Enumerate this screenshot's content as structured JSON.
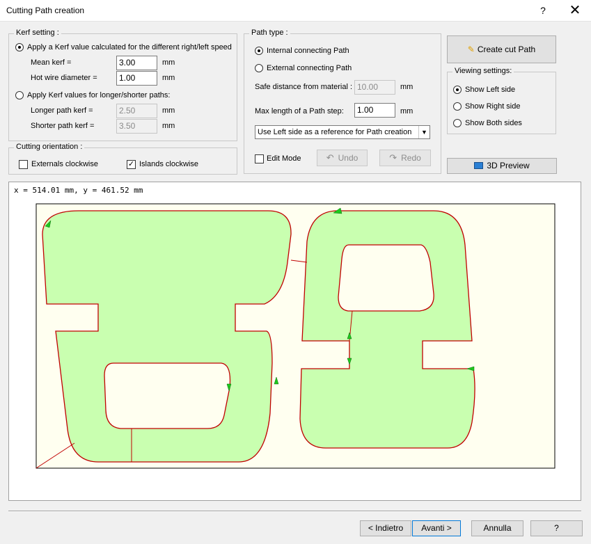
{
  "window": {
    "title": "Cutting Path creation",
    "help": "?",
    "close": "✕"
  },
  "kerf": {
    "legend": "Kerf setting :",
    "option_calc": "Apply a Kerf value calculated for the different right/left speed",
    "mean_label": "Mean kerf =",
    "mean_value": "3.00",
    "mean_unit": "mm",
    "wire_label": "Hot wire diameter =",
    "wire_value": "1.00",
    "wire_unit": "mm",
    "option_paths": "Apply Kerf values for longer/shorter paths:",
    "longer_label": "Longer path kerf =",
    "longer_value": "2.50",
    "longer_unit": "mm",
    "shorter_label": "Shorter path kerf =",
    "shorter_value": "3.50",
    "shorter_unit": "mm"
  },
  "orientation": {
    "legend": "Cutting orientation :",
    "externals": "Externals clockwise",
    "externals_checked": false,
    "islands": "Islands clockwise",
    "islands_checked": true
  },
  "path_type": {
    "legend": "Path type :",
    "internal": "Internal connecting Path",
    "external": "External connecting  Path",
    "safe_label": "Safe distance from material :",
    "safe_value": "10.00",
    "safe_unit": "mm",
    "max_label": "Max length of a Path step:",
    "max_value": "1.00",
    "max_unit": "mm",
    "reference_select": "Use Left side as a reference for Path creation",
    "edit_mode": "Edit Mode",
    "undo": "Undo",
    "redo": "Redo"
  },
  "create_button": "Create cut Path",
  "viewing": {
    "legend": "Viewing settings:",
    "left": "Show Left side",
    "right": "Show Right side",
    "both": "Show Both sides"
  },
  "preview_button": "3D Preview",
  "canvas": {
    "coords": "x = 514.01 mm, y = 461.52 mm",
    "fill_color": "#c9ffb0",
    "background_color": "#fffff0",
    "path_color": "#c00000",
    "marker_color": "#1ec81e"
  },
  "footer": {
    "back": "< Indietro",
    "next": "Avanti >",
    "cancel": "Annulla",
    "help": "?"
  }
}
